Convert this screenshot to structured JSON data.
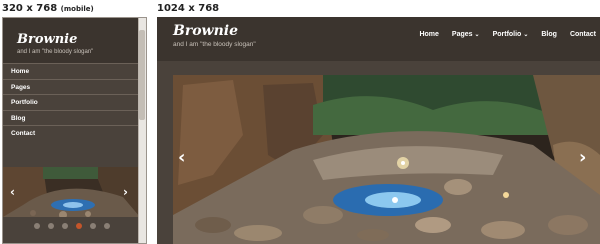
{
  "captions": {
    "mobile_size": "320 x 768",
    "mobile_note": "(mobile)",
    "desktop_size": "1024 x 768"
  },
  "site": {
    "logo": "Brownie",
    "slogan": "and I am \"the bloody slogan\""
  },
  "mobile_nav": [
    {
      "label": "Home",
      "has_submenu": false
    },
    {
      "label": "Pages",
      "has_submenu": true
    },
    {
      "label": "Portfolio",
      "has_submenu": true
    },
    {
      "label": "Blog",
      "has_submenu": false
    },
    {
      "label": "Contact",
      "has_submenu": false
    }
  ],
  "desktop_nav": [
    {
      "label": "Home",
      "has_submenu": false
    },
    {
      "label": "Pages",
      "has_submenu": true
    },
    {
      "label": "Portfolio",
      "has_submenu": true
    },
    {
      "label": "Blog",
      "has_submenu": false
    },
    {
      "label": "Contact",
      "has_submenu": false
    }
  ],
  "slider": {
    "prev_icon": "chevron-left-icon",
    "next_icon": "chevron-right-icon",
    "dot_count": 6,
    "active_dot": 4
  },
  "colors": {
    "header_bg": "#3b342e",
    "body_bg": "#4a423b",
    "active_dot": "#c4552a"
  }
}
